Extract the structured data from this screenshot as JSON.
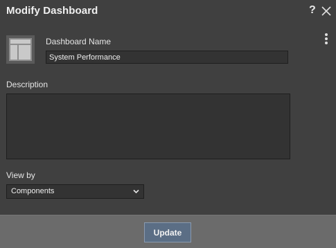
{
  "dialog": {
    "title": "Modify Dashboard",
    "help_glyph": "?"
  },
  "form": {
    "name_label": "Dashboard Name",
    "name_value": "System Performance",
    "description_label": "Description",
    "description_value": "",
    "view_by_label": "View by",
    "view_by_value": "Components"
  },
  "footer": {
    "update_label": "Update"
  },
  "icons": {
    "dashboard": "dashboard-layout-icon",
    "help": "help-icon",
    "close": "close-icon",
    "more": "kebab-menu-icon",
    "dropdown": "chevron-down-icon"
  },
  "colors": {
    "background": "#404040",
    "footer": "#6b6b6b",
    "primary_button": "#5b6e85",
    "input_bg": "#333333"
  }
}
